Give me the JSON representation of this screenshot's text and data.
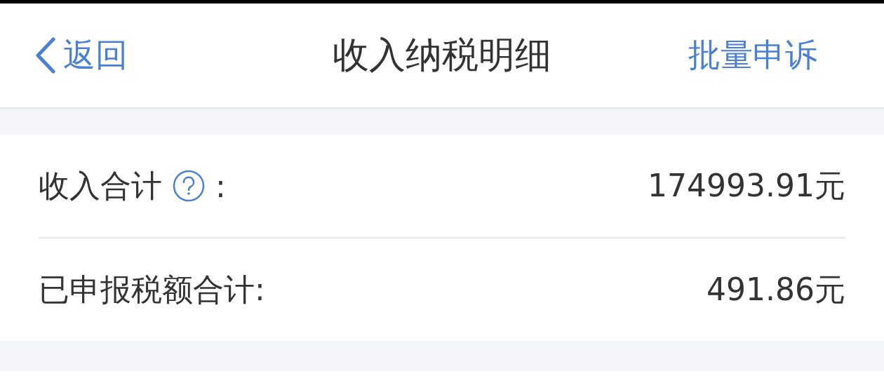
{
  "nav": {
    "back": "返回",
    "title": "收入纳税明细",
    "action": "批量申诉"
  },
  "summary": [
    {
      "label": "收入合计",
      "help": true,
      "colon": ":",
      "value": "174993.91元"
    },
    {
      "label": "已申报税额合计:",
      "help": false,
      "value": "491.86元"
    }
  ]
}
